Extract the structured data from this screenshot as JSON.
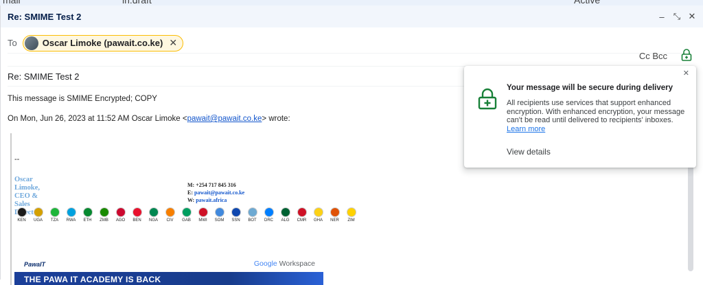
{
  "behind": {
    "app_fragment": "mail",
    "search_value": "in:draft",
    "status": "Active"
  },
  "compose": {
    "title": "Re: SMIME Test 2",
    "to_label": "To",
    "recipient": "Oscar Limoke (pawait.co.ke)",
    "cc_bcc": "Cc Bcc",
    "subject": "Re: SMIME Test 2",
    "body_line1": "This message is SMIME Encrypted; COPY",
    "quote_prefix": "On Mon, Jun 26, 2023 at 11:52 AM Oscar Limoke <",
    "quote_email": "pawait@pawait.co.ke",
    "quote_suffix": "> wrote:",
    "sig_dash": "--",
    "sig_name": "Oscar Limoke,",
    "sig_role": "CEO & Sales Director",
    "sig_mobile": "M: +254 717 845 316",
    "sig_email_label": "E: ",
    "sig_email": "pawait@pawait.co.ke",
    "sig_web_label": "W: ",
    "sig_web": "pawait.africa",
    "flags": [
      {
        "code": "KEN",
        "color": "#1a1a1a"
      },
      {
        "code": "UGA",
        "color": "#d4a000"
      },
      {
        "code": "TZA",
        "color": "#1eb53a"
      },
      {
        "code": "RWA",
        "color": "#00a1de"
      },
      {
        "code": "ETH",
        "color": "#078930"
      },
      {
        "code": "ZMB",
        "color": "#198a00"
      },
      {
        "code": "AGO",
        "color": "#cc092f"
      },
      {
        "code": "BEN",
        "color": "#e8112d"
      },
      {
        "code": "NGA",
        "color": "#008751"
      },
      {
        "code": "CIV",
        "color": "#f77f00"
      },
      {
        "code": "GAB",
        "color": "#009e60"
      },
      {
        "code": "MWI",
        "color": "#ce1126"
      },
      {
        "code": "SOM",
        "color": "#4189dd"
      },
      {
        "code": "SSN",
        "color": "#0f47af"
      },
      {
        "code": "BOT",
        "color": "#6da9d2"
      },
      {
        "code": "DRC",
        "color": "#007fff"
      },
      {
        "code": "ALG",
        "color": "#006233"
      },
      {
        "code": "CMR",
        "color": "#ce1126"
      },
      {
        "code": "GHA",
        "color": "#fcd116"
      },
      {
        "code": "NER",
        "color": "#e05206"
      },
      {
        "code": "ZIM",
        "color": "#ffd200"
      }
    ],
    "banner_brand": "PawaIT",
    "banner_workspace_google": "Google",
    "banner_workspace_word": "Workspace",
    "banner_headline": "THE PAWA IT ACADEMY IS BACK"
  },
  "popup": {
    "title": "Your message will be secure during delivery",
    "text": "All recipients use services that support enhanced encryption. With enhanced encryption, your message can't be read until delivered to recipients' inboxes.",
    "learn_more": "Learn more",
    "view_details": "View details"
  },
  "colors": {
    "lock_green": "#188038",
    "chip_border": "#fbbc04",
    "link": "#1155cc"
  }
}
